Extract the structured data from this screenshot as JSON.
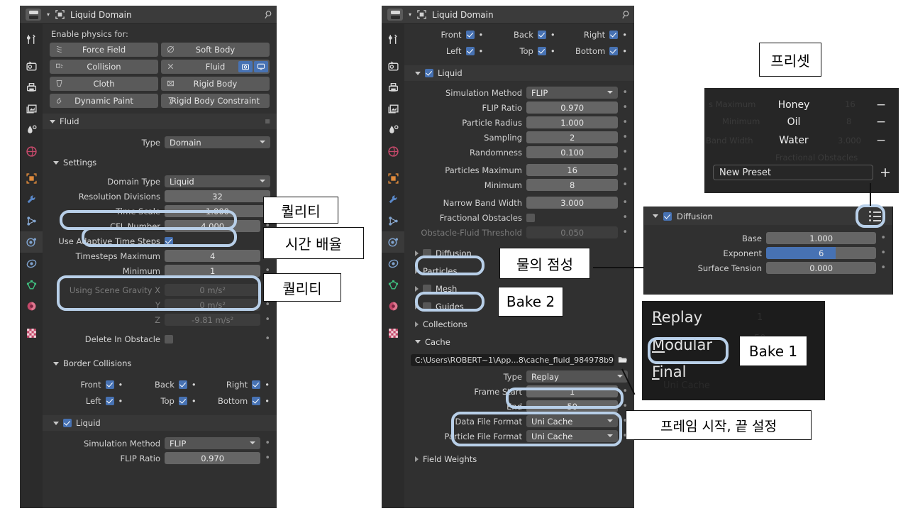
{
  "left_panel": {
    "header": {
      "title": "Liquid Domain",
      "editor_icon": "editor-type-icon",
      "object_icon": "object-data-icon",
      "pin_icon": "pin-icon"
    },
    "enable_physics_label": "Enable physics for:",
    "physics_buttons": [
      {
        "label": "Force Field",
        "icon": "force-field-icon"
      },
      {
        "label": "Soft Body",
        "icon": "soft-body-icon"
      },
      {
        "label": "Collision",
        "icon": "collision-icon"
      },
      {
        "label": "Fluid",
        "icon": "x-icon",
        "active": true,
        "toggles": [
          "camera-icon",
          "display-icon"
        ]
      },
      {
        "label": "Cloth",
        "icon": "cloth-icon"
      },
      {
        "label": "Rigid Body",
        "icon": "rigid-body-icon"
      },
      {
        "label": "Dynamic Paint",
        "icon": "dynamic-paint-icon"
      },
      {
        "label": "Rigid Body Constraint",
        "icon": "rigid-body-constraint-icon"
      }
    ],
    "fluid_section": "Fluid",
    "type_label": "Type",
    "type_value": "Domain",
    "settings_section": "Settings",
    "rows": [
      {
        "label": "Domain Type",
        "value": "Liquid",
        "kind": "select"
      },
      {
        "label": "Resolution Divisions",
        "value": "32",
        "kind": "value"
      },
      {
        "label": "Time Scale",
        "value": "1.000",
        "kind": "value"
      },
      {
        "label": "CFL Number",
        "value": "4.000",
        "kind": "value"
      }
    ],
    "adaptive_label": "Use Adaptive Time Steps",
    "timesteps": [
      {
        "label": "Timesteps Maximum",
        "value": "4"
      },
      {
        "label": "Minimum",
        "value": "1"
      }
    ],
    "gravity": [
      {
        "label": "Using Scene Gravity X",
        "value": "0 m/s²"
      },
      {
        "label": "Y",
        "value": "0 m/s²"
      },
      {
        "label": "Z",
        "value": "-9.81 m/s²"
      }
    ],
    "delete_in_obstacle": "Delete In Obstacle",
    "border_collisions_section": "Border Collisions",
    "border_collisions": [
      [
        "Front",
        "Back",
        "Right"
      ],
      [
        "Left",
        "Top",
        "Bottom"
      ]
    ],
    "liquid_section": "Liquid",
    "liquid_rows": [
      {
        "label": "Simulation Method",
        "value": "FLIP",
        "kind": "select"
      },
      {
        "label": "FLIP Ratio",
        "value": "0.970",
        "kind": "value"
      }
    ]
  },
  "mid_panel": {
    "header": {
      "title": "Liquid Domain"
    },
    "border_collisions": [
      [
        "Front",
        "Back",
        "Right"
      ],
      [
        "Left",
        "Top",
        "Bottom"
      ]
    ],
    "liquid_section": "Liquid",
    "rows": [
      {
        "label": "Simulation Method",
        "value": "FLIP",
        "kind": "select"
      },
      {
        "label": "FLIP Ratio",
        "value": "0.970",
        "kind": "value"
      },
      {
        "label": "Particle Radius",
        "value": "1.000",
        "kind": "value"
      },
      {
        "label": "Sampling",
        "value": "2",
        "kind": "value"
      },
      {
        "label": "Randomness",
        "value": "0.100",
        "kind": "value"
      },
      {
        "label": "Particles Maximum",
        "value": "16",
        "kind": "value"
      },
      {
        "label": "Minimum",
        "value": "8",
        "kind": "value"
      },
      {
        "label": "Narrow Band Width",
        "value": "3.000",
        "kind": "value"
      }
    ],
    "fractional_obstacles": "Fractional Obstacles",
    "obstacle_threshold": {
      "label": "Obstacle-Fluid Threshold",
      "value": "0.050"
    },
    "sub_sections": [
      {
        "label": "Diffusion",
        "checkbox": true
      },
      {
        "label": "Particles",
        "checkbox": false
      },
      {
        "label": "Mesh",
        "checkbox": true
      },
      {
        "label": "Guides",
        "checkbox": true
      },
      {
        "label": "Collections",
        "checkbox": false
      }
    ],
    "cache_section": "Cache",
    "cache_path": "C:\\Users\\ROBERT~1\\App...8\\cache_fluid_984978b9",
    "cache_rows": [
      {
        "label": "Type",
        "value": "Replay",
        "kind": "select"
      },
      {
        "label": "Frame Start",
        "value": "1",
        "kind": "value"
      },
      {
        "label": "End",
        "value": "50",
        "kind": "value"
      },
      {
        "label": "Data File Format",
        "value": "Uni Cache",
        "kind": "select"
      },
      {
        "label": "Particle File Format",
        "value": "Uni Cache",
        "kind": "select"
      }
    ],
    "field_weights": "Field Weights"
  },
  "preset_overlay": {
    "items": [
      {
        "name": "Honey",
        "remove": "−"
      },
      {
        "name": "Oil",
        "remove": "−"
      },
      {
        "name": "Water",
        "remove": "−"
      }
    ],
    "new_preset_placeholder": "New Preset",
    "add": "+",
    "ghost_rows": [
      {
        "label": "s Maximum",
        "value": "16"
      },
      {
        "label": "Minimum",
        "value": "8"
      },
      {
        "label": "Band Width",
        "value": "3.000"
      },
      {
        "label": "Fractional Obstacles",
        "value": ""
      }
    ]
  },
  "diffusion_overlay": {
    "title": "Diffusion",
    "list_icon": "preset-list-icon",
    "rows": [
      {
        "label": "Base",
        "value": "1.000",
        "fill": 0
      },
      {
        "label": "Exponent",
        "value": "6",
        "fill": 63
      },
      {
        "label": "Surface Tension",
        "value": "0.000",
        "fill": 0
      }
    ]
  },
  "enum_overlay": {
    "items": [
      {
        "label": "Replay",
        "accel": "R"
      },
      {
        "label": "Modular",
        "accel": "M",
        "highlighted": true
      },
      {
        "label": "Final",
        "accel": "F"
      }
    ],
    "ghost": [
      "1",
      "50",
      "Uni Cache"
    ]
  },
  "annotations": [
    {
      "id": "quality-1",
      "text": "퀄리티"
    },
    {
      "id": "time-scale",
      "text": "시간 배율"
    },
    {
      "id": "quality-2",
      "text": "퀄리티"
    },
    {
      "id": "preset",
      "text": "프리셋"
    },
    {
      "id": "viscosity",
      "text": "물의 점성"
    },
    {
      "id": "bake-2",
      "text": "Bake 2"
    },
    {
      "id": "bake-1",
      "text": "Bake 1"
    },
    {
      "id": "frame-range",
      "text": "프레임 시작, 끝 설정"
    }
  ],
  "colors": {
    "panel_bg": "#303030",
    "header_bg": "#3b3b3b",
    "field_bg": "#656565",
    "accent_blue": "#4772b3",
    "highlight": "#b8cfe8",
    "tab_bg": "#2b2b2b"
  }
}
